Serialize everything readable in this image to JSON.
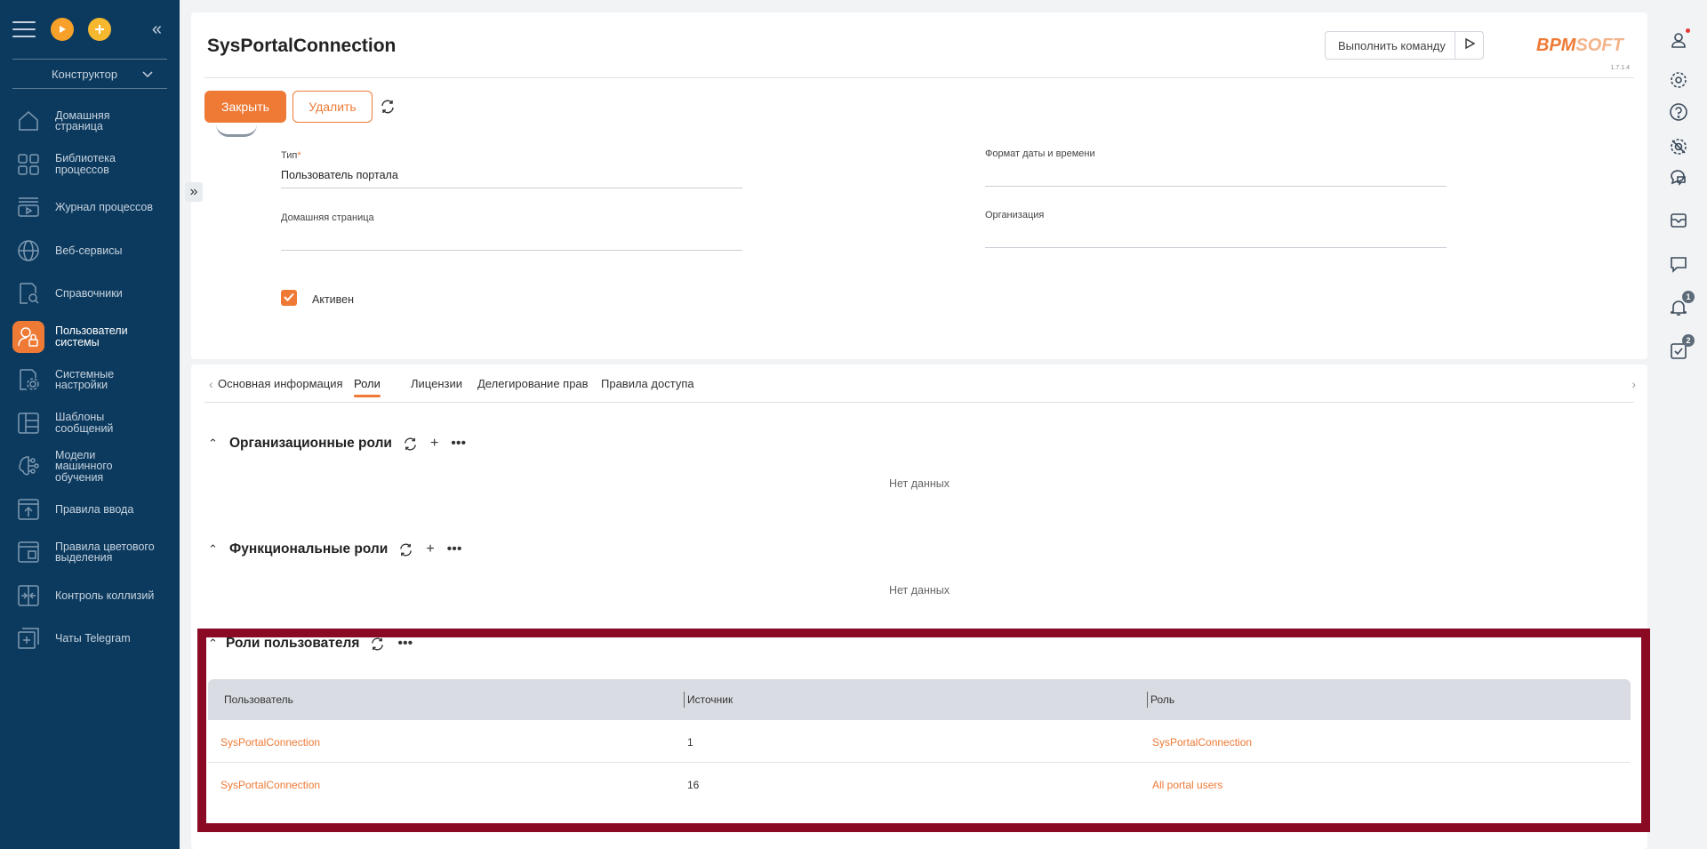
{
  "sidebar": {
    "play_icon": "play-icon",
    "add_icon": "plus-icon",
    "workspace": "Конструктор",
    "items": [
      {
        "label": "Домашняя\nстраница",
        "icon": "home-icon"
      },
      {
        "label": "Библиотека\nпроцессов",
        "icon": "process-library-icon"
      },
      {
        "label": "Журнал процессов",
        "icon": "process-log-icon"
      },
      {
        "label": "Веб-сервисы",
        "icon": "globe-icon"
      },
      {
        "label": "Справочники",
        "icon": "lookup-icon"
      },
      {
        "label": "Пользователи\nсистемы",
        "icon": "users-lock-icon"
      },
      {
        "label": "Системные\nнастройки",
        "icon": "system-settings-icon"
      },
      {
        "label": "Шаблоны\nсообщений",
        "icon": "templates-icon"
      },
      {
        "label": "Модели\nмашинного\nобучения",
        "icon": "ml-icon"
      },
      {
        "label": "Правила ввода",
        "icon": "input-rules-icon"
      },
      {
        "label": "Правила цветового\nвыделения",
        "icon": "color-rules-icon"
      },
      {
        "label": "Контроль коллизий",
        "icon": "collisions-icon"
      },
      {
        "label": "Чаты Telegram",
        "icon": "telegram-chats-icon"
      }
    ],
    "active_index": 5
  },
  "header": {
    "title": "SysPortalConnection",
    "command_placeholder": "Выполнить команду",
    "logo_main": "BPM",
    "logo_soft": "SOFT",
    "version": "1.7.1.4",
    "close_label": "Закрыть",
    "delete_label": "Удалить"
  },
  "form": {
    "type_label": "Тип",
    "type_required": "*",
    "type_value": "Пользователь портала",
    "home_page_label": "Домашняя страница",
    "home_page_value": "",
    "datetime_format_label": "Формат даты и времени",
    "datetime_format_value": "",
    "organization_label": "Организация",
    "organization_value": "",
    "active_label": "Активен",
    "active_checked": true
  },
  "tabs": [
    {
      "label": "Основная информация",
      "active": false
    },
    {
      "label": "Роли",
      "active": true
    },
    {
      "label": "Лицензии",
      "active": false
    },
    {
      "label": "Делегирование прав",
      "active": false
    },
    {
      "label": "Правила доступа",
      "active": false
    }
  ],
  "sections": {
    "org_roles": {
      "title": "Организационные роли",
      "empty": "Нет данных"
    },
    "func_roles": {
      "title": "Функциональные роли",
      "empty": "Нет данных"
    },
    "user_roles": {
      "title": "Роли пользователя",
      "columns": [
        "Пользователь",
        "Источник",
        "Роль"
      ],
      "rows": [
        {
          "user": "SysPortalConnection",
          "source": "1",
          "role": "SysPortalConnection"
        },
        {
          "user": "SysPortalConnection",
          "source": "16",
          "role": "All portal users"
        }
      ]
    }
  },
  "rightbar": {
    "notifications_count": "1",
    "tasks_count": "2"
  },
  "colors": {
    "accent": "#ee7a36",
    "sidebar_bg": "#0c3a5e",
    "highlight_border": "#8b0a23"
  }
}
